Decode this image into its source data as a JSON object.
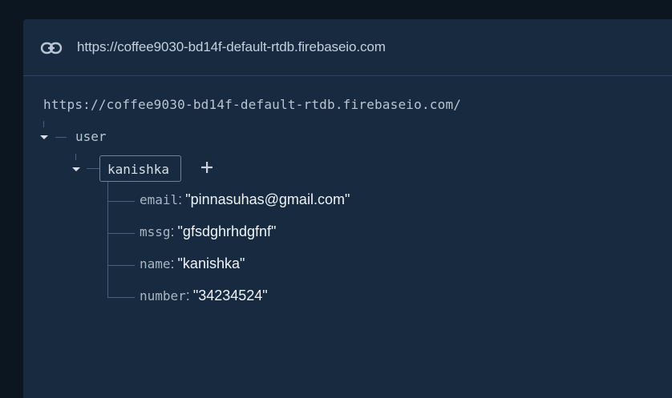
{
  "header": {
    "url": "https://coffee9030-bd14f-default-rtdb.firebaseio.com",
    "icon": "link-icon"
  },
  "tree": {
    "root_url": "https://coffee9030-bd14f-default-rtdb.firebaseio.com/",
    "user_key": "user",
    "child_key": "kanishka",
    "add_symbol": "+",
    "fields": [
      {
        "key": "email",
        "value": "\"pinnasuhas@gmail.com\""
      },
      {
        "key": "mssg",
        "value": "\"gfsdghrhdgfnf\""
      },
      {
        "key": "name",
        "value": "\"kanishka\""
      },
      {
        "key": "number",
        "value": "\"34234524\""
      }
    ]
  },
  "colors": {
    "background": "#0b1621",
    "panel": "#172a40",
    "text": "#b9c5d4",
    "value_text": "#eef3f8",
    "tree_line": "#4a5f78"
  }
}
